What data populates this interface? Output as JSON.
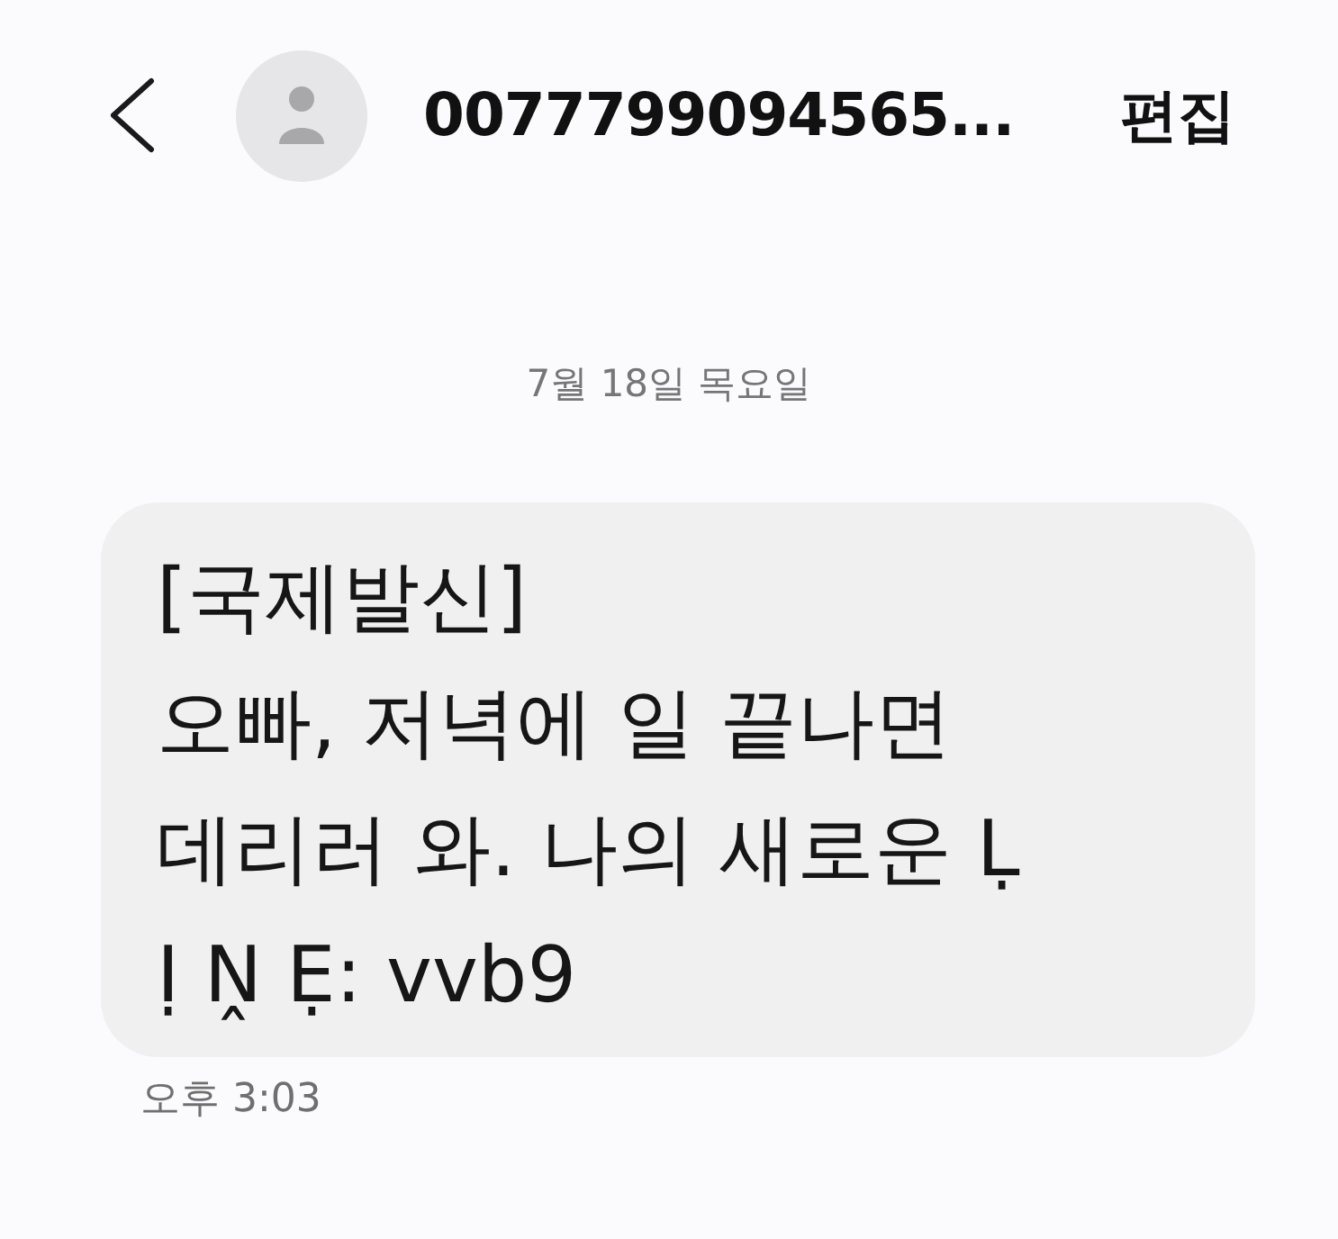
{
  "header": {
    "contact": "0077799094565...",
    "edit_label": "편집"
  },
  "date_divider": "7월 18일 목요일",
  "messages": [
    {
      "lines": [
        "[국제발신]",
        "오빠, 저녁에 일 끝나면",
        "데리러 와. 나의 새로운 Ḷ",
        "Ị Ṋ Ẹ: vvb9"
      ],
      "time": "오후 3:03"
    }
  ]
}
